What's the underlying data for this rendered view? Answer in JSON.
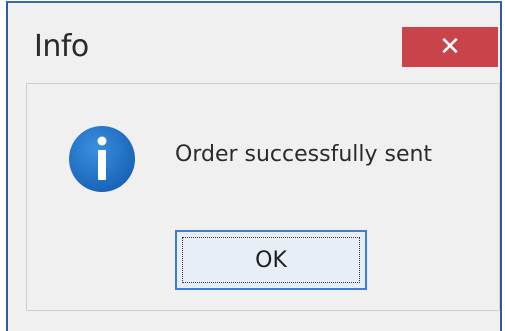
{
  "dialog": {
    "title": "Info",
    "close_glyph": "✕",
    "message": "Order successfully sent",
    "icon": "info-icon",
    "ok_label": "OK"
  },
  "colors": {
    "close_button": "#c9444a",
    "info_icon": "#1e73c8",
    "window_border": "#2f5c96",
    "ok_border": "#3c7fd0"
  }
}
